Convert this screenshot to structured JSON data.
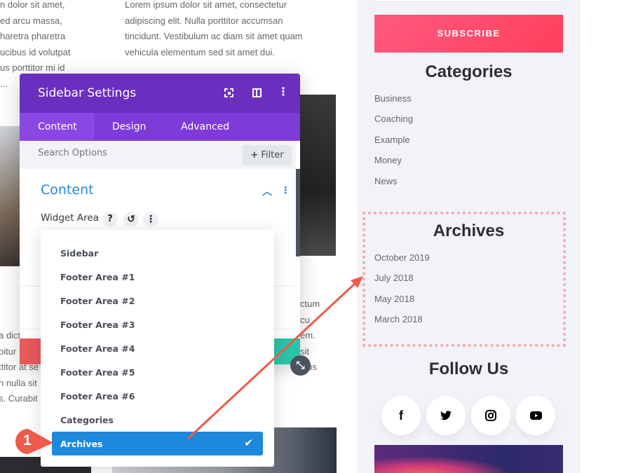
{
  "background": {
    "col1_lines": [
      "n dolor sit amet,",
      "ed arcu massa,",
      "haretra pharetra",
      "ucibus id volutpat",
      "us porttitor mi id",
      "..."
    ],
    "col2_lines": [
      "Lorem ipsum dolor sit amet, consectetur",
      "adipiscing elit. Nulla porttitor accumsan",
      "tincidunt. Vestibulum ac diam sit amet quam",
      "vehicula elementum sed sit amet dui."
    ],
    "lower_left_lines": [
      "a dict",
      "bitur",
      "ttitor at se",
      "n nulla sit",
      "s. Curabit"
    ],
    "lower_right_lines": [
      "ctum",
      "cu",
      "em.",
      "sit",
      "ctus"
    ]
  },
  "sidebar": {
    "subscribe_label": "SUBSCRIBE",
    "categories_title": "Categories",
    "categories": [
      "Business",
      "Coaching",
      "Example",
      "Money",
      "News"
    ],
    "archives_title": "Archives",
    "archives": [
      "October 2019",
      "July 2018",
      "May 2018",
      "March 2018"
    ],
    "follow_title": "Follow Us",
    "social": [
      "facebook-icon",
      "twitter-icon",
      "instagram-icon",
      "youtube-icon"
    ],
    "subscribe_color": "#ff4d6d",
    "highlight_color": "#f4a9b0"
  },
  "modal": {
    "title": "Sidebar Settings",
    "tabs": [
      "Content",
      "Design",
      "Advanced"
    ],
    "active_tab": "Content",
    "search_placeholder": "Search Options",
    "filter_label": "Filter",
    "section_title": "Content",
    "field_label": "Widget Area",
    "options": [
      "Sidebar",
      "Footer Area #1",
      "Footer Area #2",
      "Footer Area #3",
      "Footer Area #4",
      "Footer Area #5",
      "Footer Area #6",
      "Categories",
      "Archives"
    ],
    "selected": "Archives",
    "header_color": "#6b2fc0",
    "accent_color": "#2b87da"
  },
  "annotation": {
    "step": "1",
    "color": "#f05a4a"
  }
}
